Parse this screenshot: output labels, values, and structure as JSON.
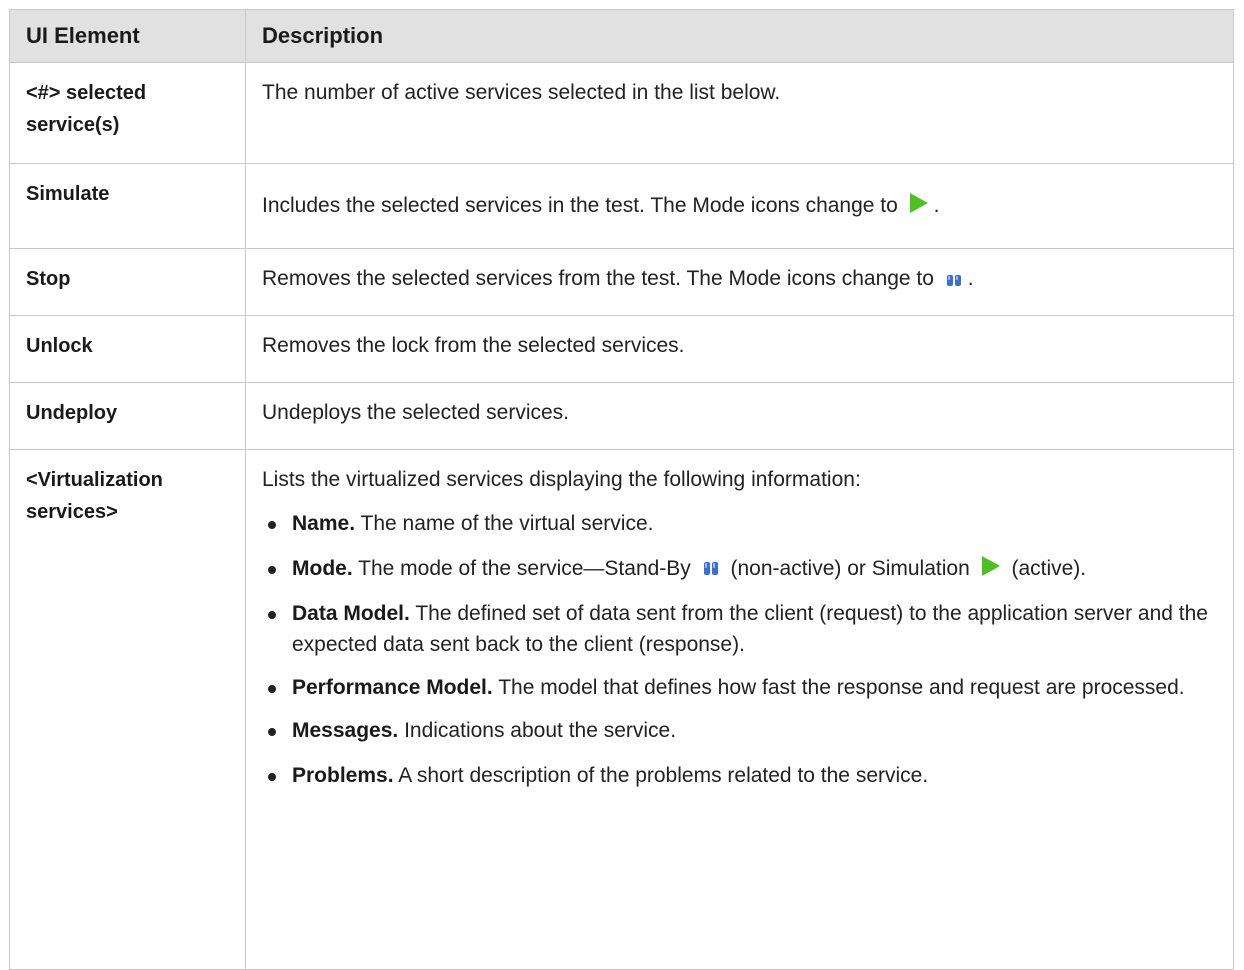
{
  "table": {
    "header": {
      "col1": "UI Element",
      "col2": "Description"
    },
    "rows": [
      {
        "element": "<#> selected service(s)",
        "description": "The number of active services selected in the list below."
      },
      {
        "element": "Simulate",
        "description_before": "Includes the selected services in the test. The Mode icons change to",
        "description_after": ".",
        "icon": "play-icon"
      },
      {
        "element": "Stop",
        "description_before": "Removes the selected services from the test. The Mode icons change to",
        "description_after": ".",
        "icon": "pause-icon"
      },
      {
        "element": "Unlock",
        "description": "Removes the lock from the selected services."
      },
      {
        "element": "Undeploy",
        "description": "Undeploys the selected services."
      },
      {
        "element": "<Virtualization services>",
        "intro": "Lists the virtualized services displaying the following information:",
        "bullets": [
          {
            "term": "Name.",
            "text": "The name of the virtual service."
          },
          {
            "term": "Mode.",
            "text_a": "The mode of the service—Stand-By",
            "text_b": "(non-active) or Simulation",
            "text_c": "(active).",
            "icons": [
              "pause-icon",
              "play-icon"
            ]
          },
          {
            "term": "Data Model.",
            "text": "The defined set of data sent from the client (request) to the application server and the expected data sent back to the client (response)."
          },
          {
            "term": "Performance Model.",
            "text": "The model that defines how fast the response and request are processed."
          },
          {
            "term": "Messages.",
            "text": "Indications about the service."
          },
          {
            "term": "Problems.",
            "text": "A short description of the problems related to the service."
          }
        ]
      }
    ]
  },
  "colors": {
    "header_bg": "#e1e1e1",
    "border": "#c9c9c9",
    "play_icon": "#4cc21e",
    "pause_icon": "#3a6fd8"
  }
}
